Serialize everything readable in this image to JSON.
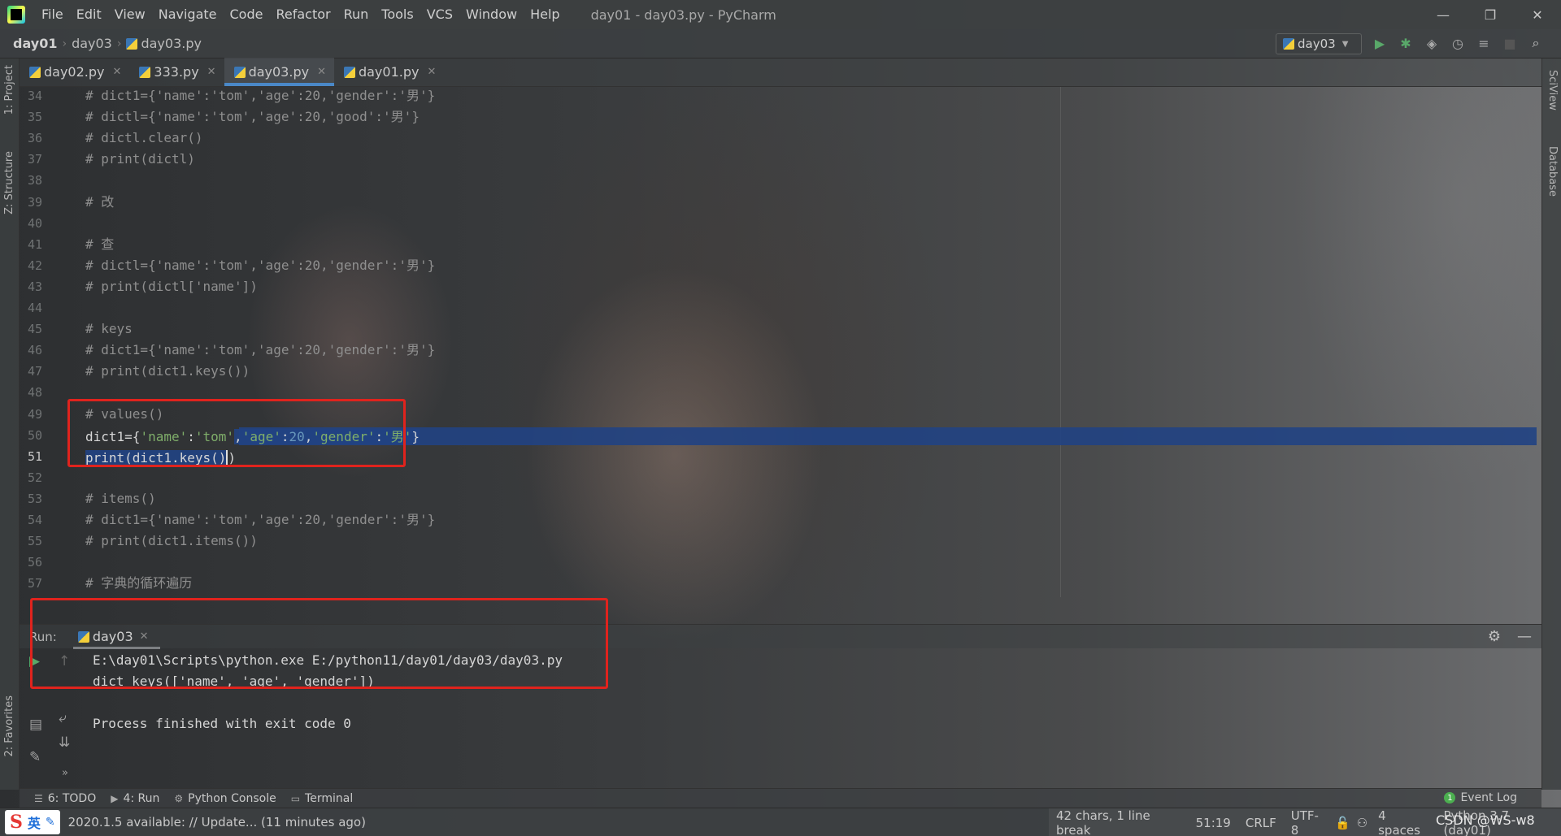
{
  "window": {
    "title": "day01 - day03.py - PyCharm",
    "controls": {
      "minimize": "—",
      "restore": "❐",
      "close": "✕"
    }
  },
  "menu": [
    "File",
    "Edit",
    "View",
    "Navigate",
    "Code",
    "Refactor",
    "Run",
    "Tools",
    "VCS",
    "Window",
    "Help"
  ],
  "breadcrumbs": [
    "day01",
    "day03",
    "day03.py"
  ],
  "run_config": {
    "name": "day03"
  },
  "tabs": [
    {
      "label": "day02.py"
    },
    {
      "label": "333.py"
    },
    {
      "label": "day03.py",
      "active": true
    },
    {
      "label": "day01.py"
    }
  ],
  "left_tool_windows": [
    "1: Project",
    "Z: Structure",
    "2: Favorites"
  ],
  "right_tool_windows": [
    "SciView",
    "Database"
  ],
  "editor": {
    "current_line": 51,
    "lines": [
      {
        "n": "34",
        "text": "# dict1={'name':'tom','age':20,'gender':'男'}"
      },
      {
        "n": "35",
        "text": "# dictl={'name':'tom','age':20,'good':'男'}"
      },
      {
        "n": "36",
        "text": "# dictl.clear()"
      },
      {
        "n": "37",
        "text": "# print(dictl)"
      },
      {
        "n": "38",
        "text": ""
      },
      {
        "n": "39",
        "text": "# 改"
      },
      {
        "n": "40",
        "text": ""
      },
      {
        "n": "41",
        "text": "# 查"
      },
      {
        "n": "42",
        "text": "# dictl={'name':'tom','age':20,'gender':'男'}"
      },
      {
        "n": "43",
        "text": "# print(dictl['name'])"
      },
      {
        "n": "44",
        "text": ""
      },
      {
        "n": "45",
        "text": "# keys"
      },
      {
        "n": "46",
        "text": "# dict1={'name':'tom','age':20,'gender':'男'}"
      },
      {
        "n": "47",
        "text": "# print(dict1.keys())"
      },
      {
        "n": "48",
        "text": ""
      },
      {
        "n": "49",
        "text": "# values()"
      },
      {
        "n": "50",
        "text": ""
      },
      {
        "n": "51",
        "text": ""
      },
      {
        "n": "52",
        "text": ""
      },
      {
        "n": "53",
        "text": "# items()"
      },
      {
        "n": "54",
        "text": "# dict1={'name':'tom','age':20,'gender':'男'}"
      },
      {
        "n": "55",
        "text": "# print(dict1.items())"
      },
      {
        "n": "56",
        "text": ""
      },
      {
        "n": "57",
        "text": "# 字典的循环遍历"
      }
    ],
    "line50": {
      "a": "dict1={",
      "s1": "'name'",
      "c1": ":",
      "s2": "'tom'",
      "c2": ",",
      "s3": "'age'",
      "c3": ":",
      "n1": "20",
      "c4": ",",
      "s4": "'gender'",
      "c5": ":",
      "s5": "'男'",
      "z": "}"
    },
    "line51": {
      "sel": "print(dict1.keys()",
      "rest": ")"
    }
  },
  "run_panel": {
    "label": "Run:",
    "tab": "day03",
    "output": [
      "E:\\day01\\Scripts\\python.exe E:/python11/day01/day03/day03.py",
      "dict_keys(['name', 'age', 'gender'])",
      "",
      "Process finished with exit code 0"
    ]
  },
  "bottom_tools": [
    {
      "label": "6: TODO",
      "icon": "☰"
    },
    {
      "label": "4: Run",
      "icon": "▶"
    },
    {
      "label": "Python Console",
      "icon": "⚙"
    },
    {
      "label": "Terminal",
      "icon": "▭"
    }
  ],
  "event_log": {
    "label": "Event Log",
    "count": "1"
  },
  "status": {
    "message": "2020.1.5 available: // Update... (11 minutes ago)",
    "ime_lang": "英",
    "chars": "42 chars, 1 line break",
    "position": "51:19",
    "line_sep": "CRLF",
    "encoding": "UTF-8",
    "indent": "4 spaces",
    "interpreter": "Python 3.7 (day01)",
    "watermark": "CSDN @WS-w8"
  },
  "colors": {
    "selection": "#214283",
    "red_box": "#e0231d",
    "tab_underline": "#4a88c7",
    "run_green": "#4caf50"
  }
}
